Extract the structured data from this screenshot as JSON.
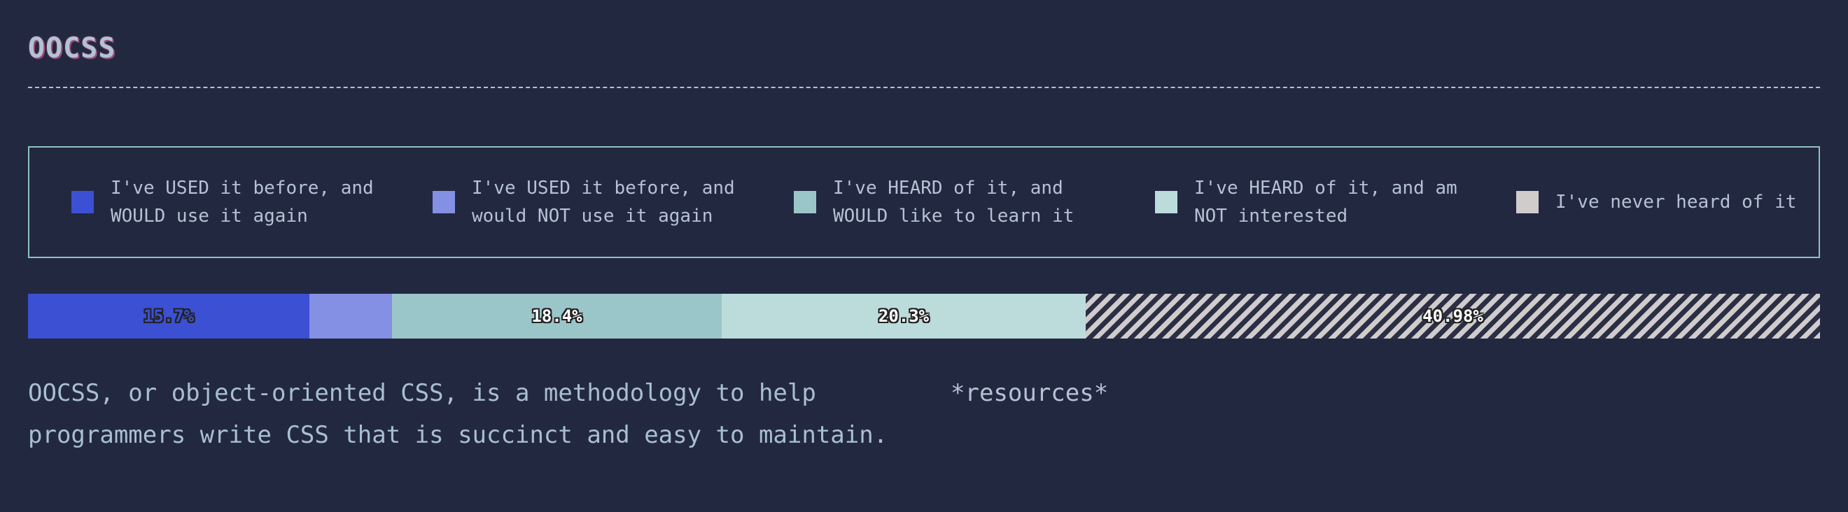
{
  "title": "OOCSS",
  "colors": {
    "background": "#232841",
    "used_would": "#3b50d2",
    "used_not": "#8390e3",
    "heard_learn": "#9bc6c9",
    "heard_not": "#bbdcdb",
    "never": "#d0cccc"
  },
  "legend": [
    {
      "label": "I've USED it before, and WOULD use it again",
      "color": "#3b50d2"
    },
    {
      "label": "I've USED it before, and would NOT use it again",
      "color": "#8390e3"
    },
    {
      "label": "I've HEARD of it, and WOULD like to learn it",
      "color": "#9bc6c9"
    },
    {
      "label": "I've HEARD of it, and am NOT interested",
      "color": "#bbdcdb"
    },
    {
      "label": "I've never heard of it",
      "color": "#d0cccc"
    }
  ],
  "chart_data": {
    "type": "bar",
    "orientation": "horizontal-stacked-100",
    "categories": [
      "I've USED it before, and WOULD use it again",
      "I've USED it before, and would NOT use it again",
      "I've HEARD of it, and WOULD like to learn it",
      "I've HEARD of it, and am NOT interested",
      "I've never heard of it"
    ],
    "values": [
      15.7,
      4.62,
      18.4,
      20.3,
      40.98
    ],
    "data_labels": [
      "15.7%",
      "",
      "18.4%",
      "20.3%",
      "40.98%"
    ],
    "colors": [
      "#3b50d2",
      "#8390e3",
      "#9bc6c9",
      "#bbdcdb",
      "#d0cccc"
    ],
    "patterns": [
      "solid",
      "solid",
      "solid",
      "solid",
      "diagonal-stripes"
    ],
    "label_colors": [
      "#3b50d2",
      "#ffffff",
      "#ffffff",
      "#ffffff",
      "#ffffff"
    ],
    "xlim": [
      0,
      100
    ],
    "legend_position": "top"
  },
  "description": "OOCSS, or object-oriented CSS, is a methodology to help programmers write CSS that is succinct and easy to maintain.",
  "resources_label": "*resources*"
}
